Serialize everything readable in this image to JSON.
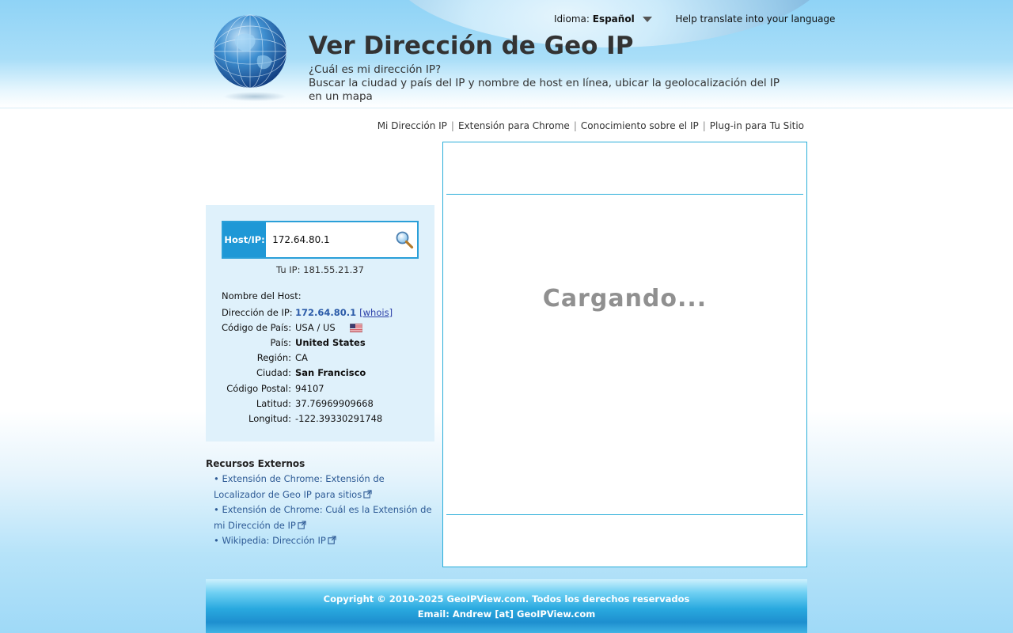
{
  "header": {
    "title": "Ver Dirección de Geo IP",
    "subtitle_line1": "¿Cuál es mi dirección IP?",
    "subtitle_line2": "Buscar la ciudad y país del IP y nombre de host en línea, ubicar la geolocalización del IP en un mapa",
    "language_label": "Idioma:",
    "language_value": "Español",
    "help_translate": "Help translate into your language"
  },
  "nav": {
    "items": [
      "Mi Dirección IP",
      "Extensión para Chrome",
      "Conocimiento sobre el IP",
      "Plug-in para Tu Sitio"
    ],
    "separator": "|"
  },
  "lookup": {
    "label": "Host/IP:",
    "input_value": "172.64.80.1",
    "your_ip": "Tu IP: 181.55.21.37",
    "host_name_label": "Nombre del Host:",
    "rows": [
      {
        "label": "Dirección de IP:",
        "value": "172.64.80.1",
        "extra": "whois"
      },
      {
        "label": "Código de País:",
        "value": "USA / US"
      },
      {
        "label": "País:",
        "value": "United States"
      },
      {
        "label": "Región:",
        "value": "CA"
      },
      {
        "label": "Ciudad:",
        "value": "San Francisco"
      },
      {
        "label": "Código Postal:",
        "value": "94107"
      },
      {
        "label": "Latitud:",
        "value": "37.76969909668"
      },
      {
        "label": "Longitud:",
        "value": "-122.39330291748"
      }
    ]
  },
  "resources": {
    "title": "Recursos Externos",
    "items": [
      {
        "bullet": "•",
        "text": "Extensión de Chrome: Extensión de Localizador de Geo IP para sitios"
      },
      {
        "bullet": "•",
        "text": "Extensión de Chrome: Cuál es la Extensión de mi Dirección de IP"
      },
      {
        "bullet": "•",
        "text": "Wikipedia: Dirección IP"
      }
    ]
  },
  "map": {
    "loading_text": "Cargando..."
  },
  "footer": {
    "copyright": "Copyright © 2010-2025 GeoIPView.com. Todos los derechos reservados",
    "email": "Email: Andrew [at] GeoIPView.com"
  },
  "icons": {
    "logo": "globe-icon",
    "search": "magnifier-icon",
    "flag": "us-flag-icon",
    "external": "external-link-icon",
    "language_caret": "caret-down-icon"
  },
  "colors": {
    "accent": "#1f98d6",
    "panel_border": "#2aaed9",
    "lookup_bg": "#dff1fb",
    "link": "#2d5a95",
    "loading_text": "#909090"
  }
}
